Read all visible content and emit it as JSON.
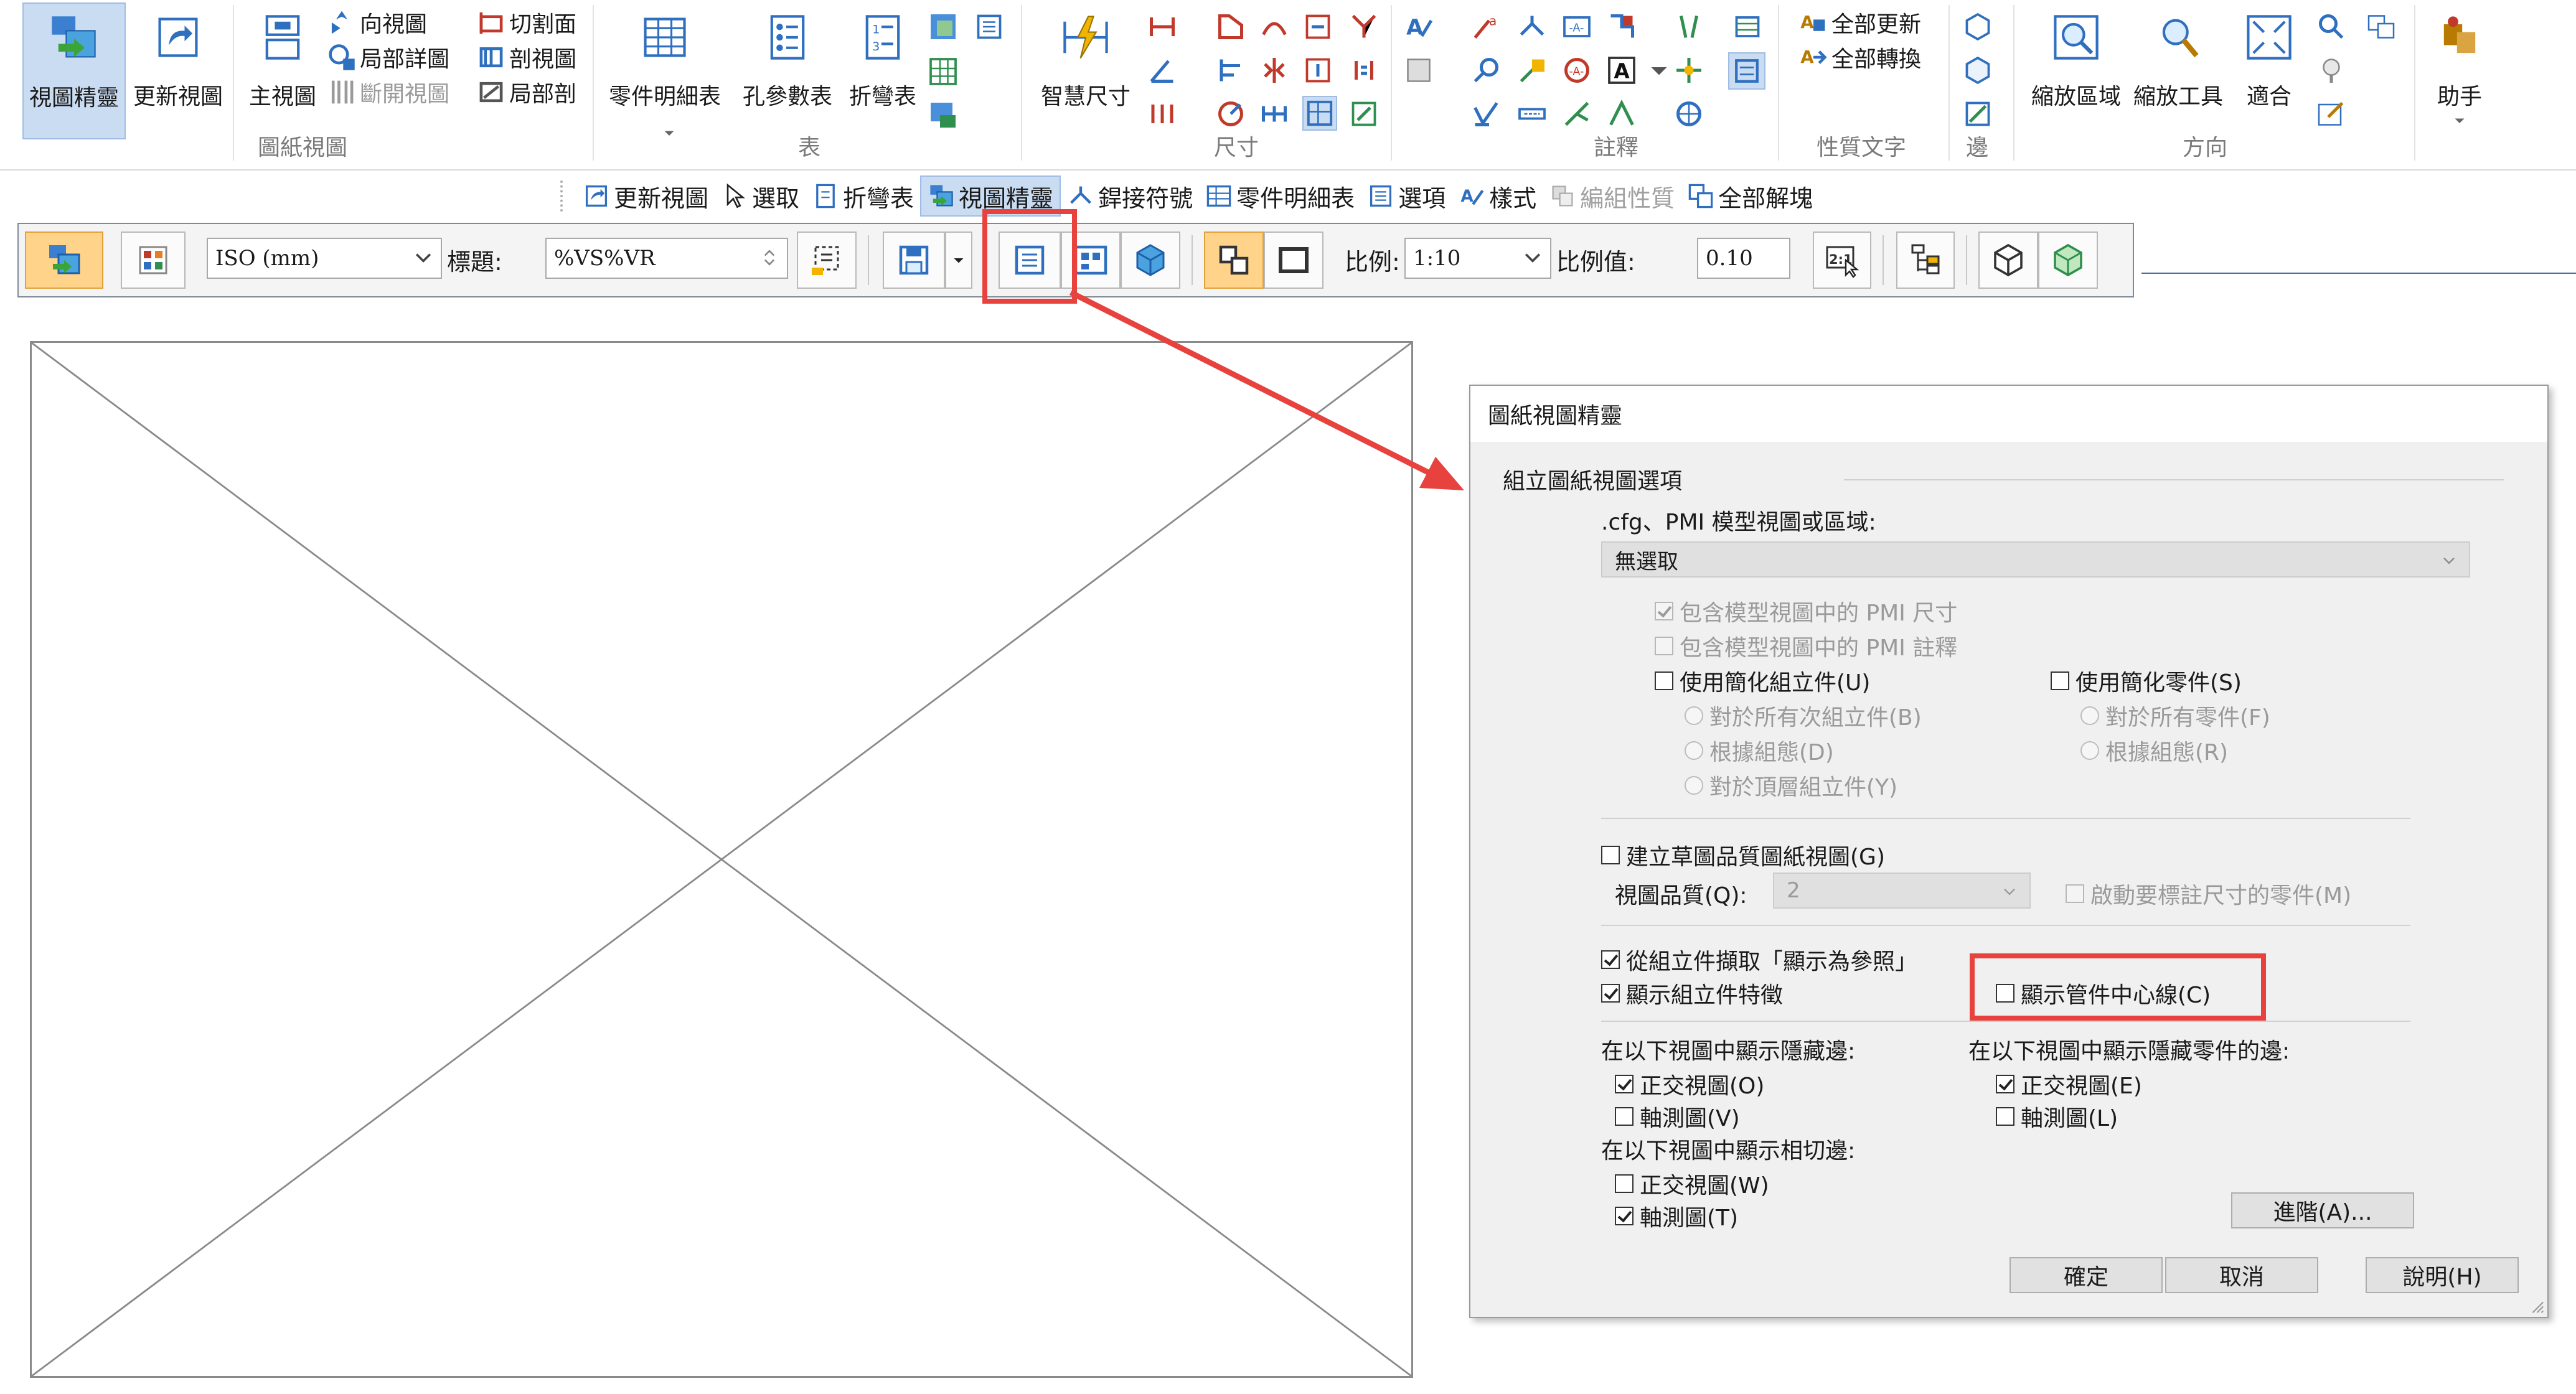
{
  "ribbon": {
    "buttons": {
      "view_wizard": "視圖精靈",
      "update_views": "更新視圖",
      "principal_view": "主視圖",
      "smart_dimension": "智慧尺寸",
      "bom": "零件明細表",
      "hole_table": "孔參數表",
      "bend_table": "折彎表",
      "zoom_area": "縮放區域",
      "zoom_tool": "縮放工具",
      "fit": "適合",
      "assistant": "助手"
    },
    "small": {
      "auxiliary_view": "向視圖",
      "detail_view": "局部詳圖",
      "broken_view": "斷開視圖",
      "section_plane": "切割面",
      "section_view": "剖視圖",
      "broken_out": "局部剖",
      "update_all": "全部更新",
      "convert_all": "全部轉換"
    },
    "groups": {
      "drawing_views": "圖紙視圖",
      "tables": "表",
      "dimension": "尺寸",
      "annotation": "註釋",
      "property_text": "性質文字",
      "edges": "邊",
      "orient": "方向"
    }
  },
  "cmdbar": {
    "items": [
      "更新視圖",
      "選取",
      "折彎表",
      "視圖精靈",
      "銲接符號",
      "零件明細表",
      "選項",
      "樣式",
      "編組性質",
      "全部解塊"
    ],
    "active_index": 3,
    "disabled_index": 8
  },
  "viewbar": {
    "standard": "ISO (mm)",
    "caption_label": "標題:",
    "caption_value": "%VS%VR",
    "scale_label": "比例:",
    "scale_value": "1:10",
    "scale_value_label": "比例值:",
    "scale_number": "0.10"
  },
  "dialog": {
    "title": "圖紙視圖精靈",
    "section_title": "組立圖紙視圖選項",
    "source_label": ".cfg、PMI 模型視圖或區域:",
    "source_value": "無選取",
    "pmi_dims": {
      "label": "包含模型視圖中的 PMI 尺寸",
      "checked": true
    },
    "pmi_notes": {
      "label": "包含模型視圖中的 PMI 註釋",
      "checked": false
    },
    "simplified_assembly": {
      "label": "使用簡化組立件(U)",
      "checked": false
    },
    "simplified_part": {
      "label": "使用簡化零件(S)",
      "checked": false
    },
    "radio_all_sub": "對於所有次組立件(B)",
    "radio_config_left": "根據組態(D)",
    "radio_top": "對於頂層組立件(Y)",
    "radio_all_parts": "對於所有零件(F)",
    "radio_config_right": "根據組態(R)",
    "draft_quality": {
      "label": "建立草圖品質圖紙視圖(G)",
      "checked": false
    },
    "view_quality_label": "視圖品質(Q):",
    "view_quality_value": "2",
    "activate_parts": {
      "label": "啟動要標註尺寸的零件(M)",
      "checked": false
    },
    "show_as_reference": {
      "label": "從組立件擷取「顯示為參照」",
      "checked": true
    },
    "show_features": {
      "label": "顯示組立件特徵",
      "checked": true
    },
    "show_centerlines": {
      "label": "顯示管件中心線(C)",
      "checked": false
    },
    "hidden_edges_title": "在以下視圖中顯示隱藏邊:",
    "hidden_orth": {
      "label": "正交視圖(O)",
      "checked": true
    },
    "hidden_iso": {
      "label": "軸測圖(V)",
      "checked": false
    },
    "tangent_title": "在以下視圖中顯示相切邊:",
    "tangent_orth": {
      "label": "正交視圖(W)",
      "checked": false
    },
    "tangent_iso": {
      "label": "軸測圖(T)",
      "checked": true
    },
    "hidden_part_title": "在以下視圖中顯示隱藏零件的邊:",
    "hp_orth": {
      "label": "正交視圖(E)",
      "checked": true
    },
    "hp_iso": {
      "label": "軸測圖(L)",
      "checked": false
    },
    "advanced_button": "進階(A)...",
    "ok_button": "確定",
    "cancel_button": "取消",
    "help_button": "說明(H)"
  },
  "colors": {
    "highlight": "#e8423e",
    "active_blue": "#c9dcf2",
    "selected_orange": "#ffd48a"
  }
}
